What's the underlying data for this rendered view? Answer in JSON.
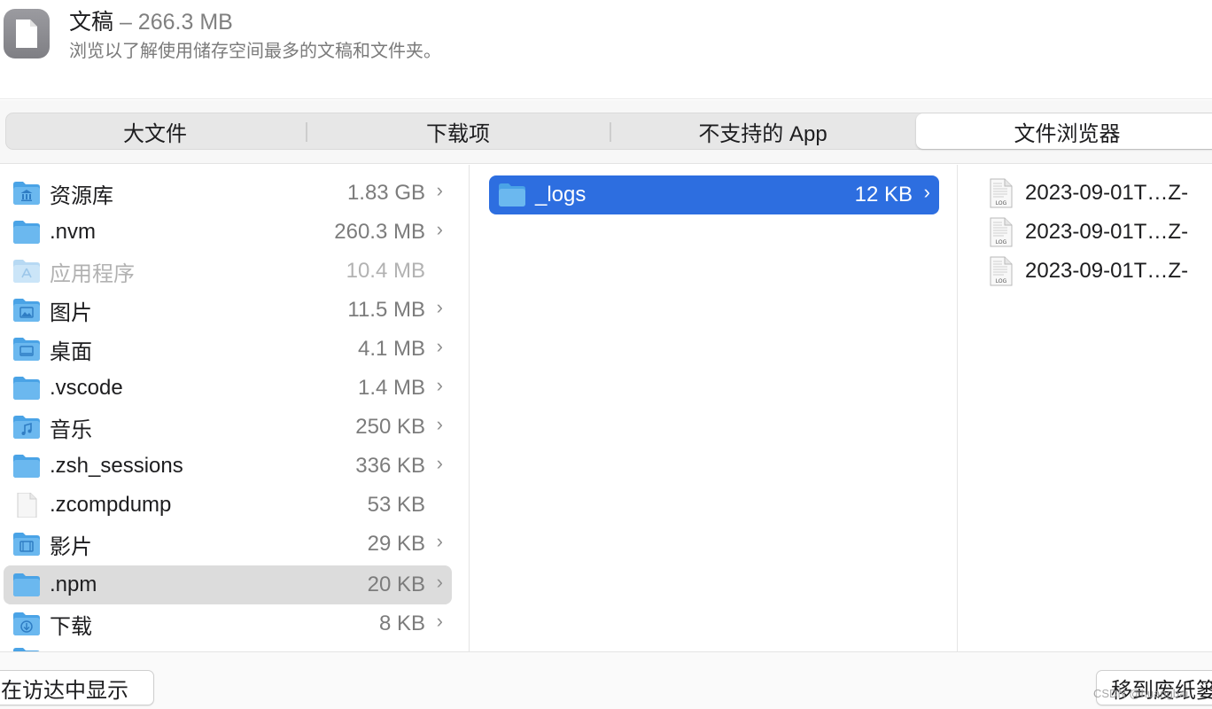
{
  "header": {
    "title": "文稿",
    "size": " – 266.3 MB",
    "subtitle": "浏览以了解使用储存空间最多的文稿和文件夹。"
  },
  "tabs": [
    {
      "label": "大文件",
      "active": false
    },
    {
      "label": "下载项",
      "active": false
    },
    {
      "label": "不支持的 App",
      "active": false
    },
    {
      "label": "文件浏览器",
      "active": true
    }
  ],
  "column1": [
    {
      "name": "资源库",
      "size": "1.83 GB",
      "chevron": "›",
      "icon": "library-folder-icon"
    },
    {
      "name": ".nvm",
      "size": "260.3 MB",
      "chevron": "›",
      "icon": "folder-icon"
    },
    {
      "name": "应用程序",
      "size": "10.4 MB",
      "icon": "applications-folder-icon",
      "dimmed": true
    },
    {
      "name": "图片",
      "size": "11.5 MB",
      "chevron": "›",
      "icon": "pictures-folder-icon"
    },
    {
      "name": "桌面",
      "size": "4.1 MB",
      "chevron": "›",
      "icon": "desktop-folder-icon"
    },
    {
      "name": ".vscode",
      "size": "1.4 MB",
      "chevron": "›",
      "icon": "folder-icon"
    },
    {
      "name": "音乐",
      "size": "250 KB",
      "chevron": "›",
      "icon": "music-folder-icon"
    },
    {
      "name": ".zsh_sessions",
      "size": "336 KB",
      "chevron": "›",
      "icon": "folder-icon"
    },
    {
      "name": ".zcompdump",
      "size": "53 KB",
      "icon": "document-icon"
    },
    {
      "name": "影片",
      "size": "29 KB",
      "chevron": "›",
      "icon": "movies-folder-icon"
    },
    {
      "name": ".npm",
      "size": "20 KB",
      "chevron": "›",
      "icon": "folder-icon",
      "highlighted": true
    },
    {
      "name": "下载",
      "size": "8 KB",
      "chevron": "›",
      "icon": "downloads-folder-icon"
    }
  ],
  "column2": [
    {
      "name": "_logs",
      "size": "12 KB",
      "chevron": "›",
      "icon": "folder-icon",
      "selected": true
    }
  ],
  "column3": [
    {
      "name": "2023-09-01T…Z-",
      "icon": "log-file-icon"
    },
    {
      "name": "2023-09-01T…Z-",
      "icon": "log-file-icon"
    },
    {
      "name": "2023-09-01T…Z-",
      "icon": "log-file-icon"
    }
  ],
  "footer": {
    "show_in_finder": "在访达中显示",
    "move_to_trash": "移到废纸篓",
    "watermark": "CSDN @huangbai"
  },
  "colors": {
    "accent": "#2d6ee0",
    "folder": "#5fb0ea",
    "row_highlight": "#dcdcdc"
  }
}
